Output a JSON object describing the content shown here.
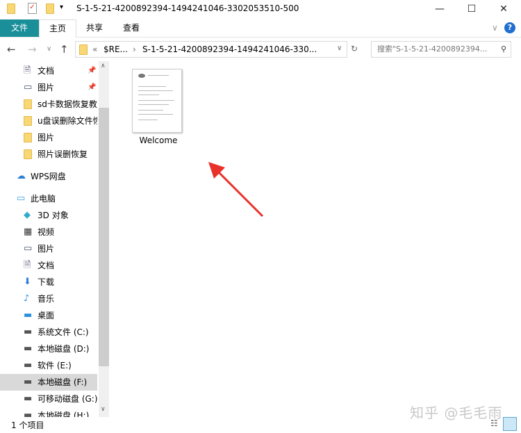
{
  "window": {
    "title": "S-1-5-21-4200892394-1494241046-3302053510-500",
    "minimize": "—",
    "maximize": "☐",
    "close": "✕"
  },
  "ribbon": {
    "tabs": [
      "文件",
      "主页",
      "共享",
      "查看"
    ],
    "expand": "∨",
    "help": "?"
  },
  "address": {
    "path": [
      "«",
      "$RE...",
      "›",
      "S-1-5-21-4200892394-1494241046-330..."
    ],
    "dropdown": "∨",
    "refresh": "↻"
  },
  "search": {
    "placeholder": "搜索\"S-1-5-21-4200892394...",
    "icon": "search-icon"
  },
  "nav": {
    "items": [
      {
        "label": "文档",
        "icon": "document",
        "pinned": true
      },
      {
        "label": "图片",
        "icon": "picture",
        "pinned": true
      },
      {
        "label": "sd卡数据恢复教",
        "icon": "folder"
      },
      {
        "label": "u盘误删除文件恢",
        "icon": "folder"
      },
      {
        "label": "图片",
        "icon": "folder"
      },
      {
        "label": "照片误删恢复",
        "icon": "folder"
      },
      {
        "label": "WPS网盘",
        "icon": "cloud"
      },
      {
        "label": "此电脑",
        "icon": "computer"
      },
      {
        "label": "3D 对象",
        "icon": "3d"
      },
      {
        "label": "视频",
        "icon": "video"
      },
      {
        "label": "图片",
        "icon": "picture"
      },
      {
        "label": "文档",
        "icon": "document"
      },
      {
        "label": "下载",
        "icon": "download"
      },
      {
        "label": "音乐",
        "icon": "music"
      },
      {
        "label": "桌面",
        "icon": "desktop"
      },
      {
        "label": "系统文件 (C:)",
        "icon": "drive"
      },
      {
        "label": "本地磁盘 (D:)",
        "icon": "drive"
      },
      {
        "label": "软件 (E:)",
        "icon": "drive"
      },
      {
        "label": "本地磁盘 (F:)",
        "icon": "drive",
        "selected": true
      },
      {
        "label": "可移动磁盘 (G:)",
        "icon": "drive"
      },
      {
        "label": "本地磁盘 (H:)",
        "icon": "drive"
      }
    ]
  },
  "files": [
    {
      "name": "Welcome"
    }
  ],
  "status": {
    "count": "1 个项目"
  },
  "watermark": "知乎 @毛毛雨",
  "colors": {
    "file_tab": "#1a8f9a",
    "arrow": "#e8312a",
    "selected": "#d9d9d9"
  }
}
